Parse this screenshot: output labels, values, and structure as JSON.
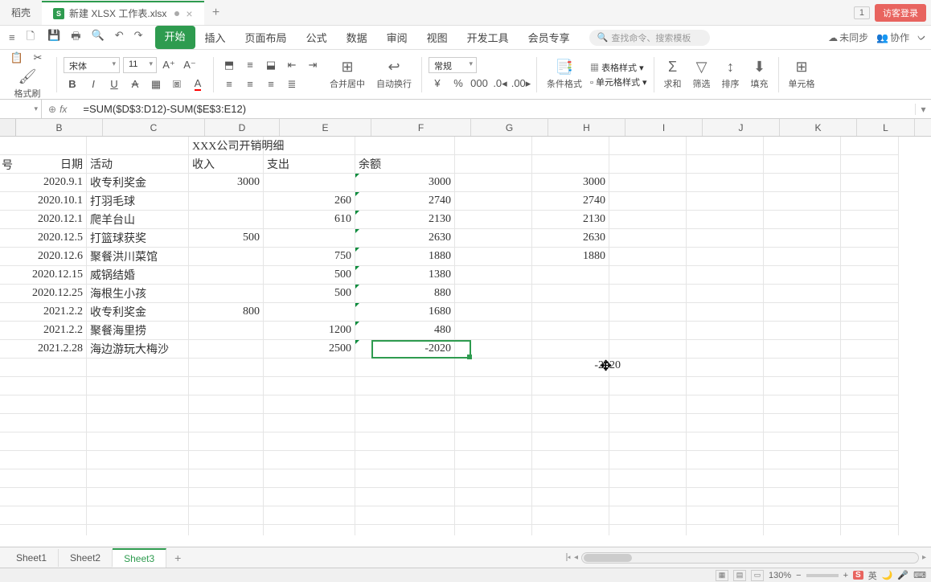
{
  "tabs": {
    "first": "稻壳",
    "active": "新建 XLSX 工作表.xlsx",
    "icon_letter": "S"
  },
  "title_right": {
    "win_num": "1",
    "login": "访客登录"
  },
  "menu": {
    "tabs": [
      "开始",
      "插入",
      "页面布局",
      "公式",
      "数据",
      "审阅",
      "视图",
      "开发工具",
      "会员专享"
    ],
    "active_index": 0,
    "search_placeholder": "查找命令、搜索模板",
    "unsync": "未同步",
    "collab": "协作",
    "chevron": "ᨆ"
  },
  "ribbon": {
    "paint": "格式刷",
    "font_name": "宋体",
    "font_size": "11",
    "merge": "合并居中",
    "wrap": "自动换行",
    "number_format": "常规",
    "cond_format": "条件格式",
    "table_style": "表格样式",
    "cell_style": "单元格样式",
    "sum": "求和",
    "filter": "筛选",
    "sort": "排序",
    "fill": "填充",
    "cell_fmt": "单元格"
  },
  "formula": {
    "name_box": "",
    "fx": "fx",
    "text": "=SUM($D$3:D12)-SUM($E$3:E12)"
  },
  "columns": [
    "B",
    "C",
    "D",
    "E",
    "F",
    "G",
    "H",
    "I",
    "J",
    "K",
    "L"
  ],
  "title_cell": "XXX公司开销明细",
  "headers": {
    "a": "号",
    "b": "日期",
    "c": "活动",
    "d": "收入",
    "e": "支出",
    "f": "余额"
  },
  "rows": [
    {
      "b": "2020.9.1",
      "c": "收专利奖金",
      "d": "3000",
      "e": "",
      "f": "3000",
      "h": "3000"
    },
    {
      "b": "2020.10.1",
      "c": "打羽毛球",
      "d": "",
      "e": "260",
      "f": "2740",
      "h": "2740"
    },
    {
      "b": "2020.12.1",
      "c": "爬羊台山",
      "d": "",
      "e": "610",
      "f": "2130",
      "h": "2130"
    },
    {
      "b": "2020.12.5",
      "c": "打篮球获奖",
      "d": "500",
      "e": "",
      "f": "2630",
      "h": "2630"
    },
    {
      "b": "2020.12.6",
      "c": "聚餐洪川菜馆",
      "d": "",
      "e": "750",
      "f": "1880",
      "h": "1880"
    },
    {
      "b": "2020.12.15",
      "c": "威锅结婚",
      "d": "",
      "e": "500",
      "f": "1380",
      "h": ""
    },
    {
      "b": "2020.12.25",
      "c": "海根生小孩",
      "d": "",
      "e": "500",
      "f": "880",
      "h": ""
    },
    {
      "b": "2021.2.2",
      "c": "收专利奖金",
      "d": "800",
      "e": "",
      "f": "1680",
      "h": ""
    },
    {
      "b": "2021.2.2",
      "c": "聚餐海里捞",
      "d": "",
      "e": "1200",
      "f": "480",
      "h": ""
    },
    {
      "b": "2021.2.28",
      "c": "海边游玩大梅沙",
      "d": "",
      "e": "2500",
      "f": "-2020",
      "h": ""
    }
  ],
  "floating_h": "-2020",
  "sheets": [
    "Sheet1",
    "Sheet2",
    "Sheet3"
  ],
  "active_sheet": 2,
  "status": {
    "zoom": "130%",
    "ime": "S",
    "lang": "英"
  }
}
